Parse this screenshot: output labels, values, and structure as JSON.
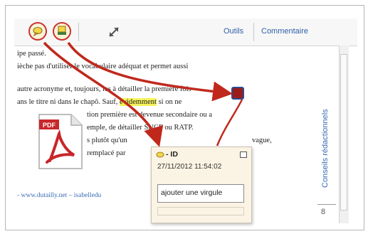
{
  "toolbar": {
    "tools_label": "Outils",
    "comment_label": "Commentaire"
  },
  "document": {
    "lines": [
      "ipe passé.",
      "ièche pas d'utiliser le vocabulaire adéquat et permet aussi",
      "autre acronyme et, toujours, les à détailler la première fois",
      "ans le titre ni dans le chapô. Sauf,",
      "si on ne",
      "tion première est devenue secondaire ou a",
      "emple, de détailler SNCF ou RATP.",
      "s plutôt qu'un",
      "vague,",
      "remplacé par",
      "- www.dutailly.net – isabelledu"
    ],
    "highlighted_word": "évidemment"
  },
  "note": {
    "title": "- ID",
    "date": "27/11/2012 11:54:02",
    "text": "ajouter une virgule"
  },
  "side_panel": {
    "vertical_label": "Conseils rédactionnels",
    "page_number": "8"
  },
  "colors": {
    "arrow": "#c0281c",
    "highlight": "#f5f25a",
    "link": "#2e5fa8",
    "pdf_red": "#c8262a"
  },
  "icons": {
    "comment_tool": "speech-bubble-icon",
    "stamp_tool": "highlight-stamp-icon",
    "expand": "expand-arrows-icon",
    "pdf": "pdf-file-icon"
  }
}
